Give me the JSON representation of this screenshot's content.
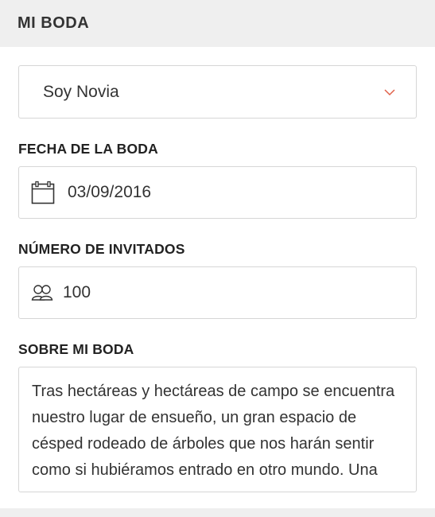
{
  "header": {
    "title": "MI BODA"
  },
  "role_select": {
    "value": "Soy Novia"
  },
  "wedding_date": {
    "label": "FECHA DE LA BODA",
    "value": "03/09/2016"
  },
  "guests": {
    "label": "NÚMERO DE INVITADOS",
    "value": "100"
  },
  "about": {
    "label": "SOBRE MI BODA",
    "text": "Tras hectáreas y hectáreas de campo se encuentra nuestro lugar de ensueño, un gran espacio de césped rodeado de árboles que nos harán sentir como si hubiéramos entrado en otro mundo. Una"
  },
  "colors": {
    "accent": "#e0614a",
    "border": "#d6d6d6",
    "header_bg": "#efefef"
  },
  "icons": {
    "select": "chevron-down-icon",
    "date": "calendar-icon",
    "guests": "people-icon"
  }
}
